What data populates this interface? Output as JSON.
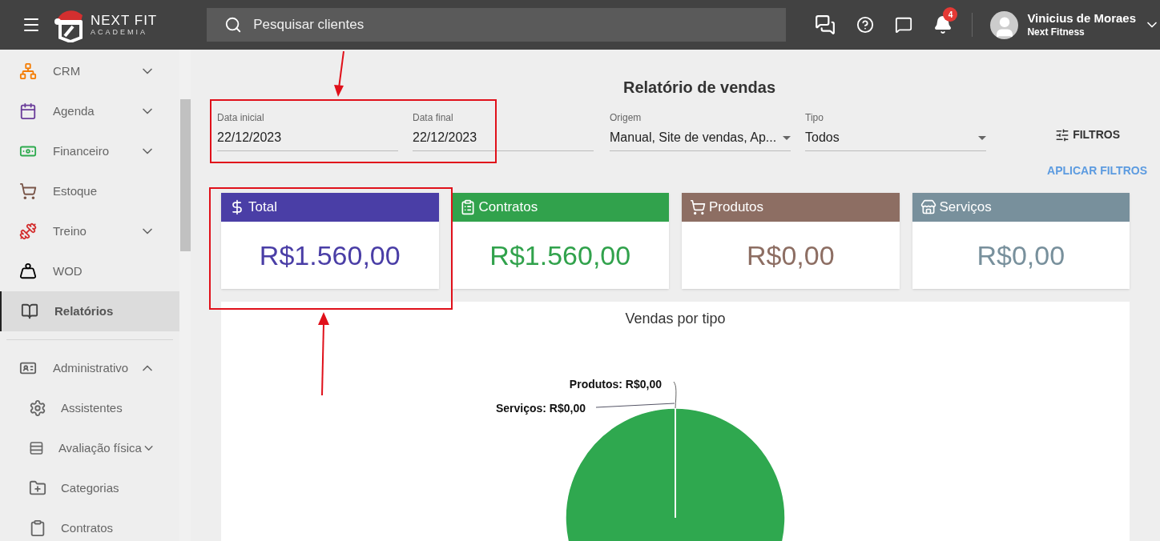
{
  "header": {
    "logo": {
      "title": "NEXT FIT",
      "subtitle": "ACADEMIA"
    },
    "search": {
      "placeholder": "Pesquisar clientes"
    },
    "notifications": {
      "count": "4"
    },
    "user": {
      "name": "Vinicius de Moraes",
      "company": "Next Fitness"
    }
  },
  "sidebar": {
    "sections": [
      {
        "items": [
          {
            "label": "CRM",
            "expanded": false,
            "selected": false
          },
          {
            "label": "Agenda",
            "expanded": false,
            "selected": false
          },
          {
            "label": "Financeiro",
            "expanded": false,
            "selected": false
          },
          {
            "label": "Estoque",
            "selected": false
          },
          {
            "label": "Treino",
            "expanded": false,
            "selected": false
          },
          {
            "label": "WOD",
            "selected": false
          },
          {
            "label": "Relatórios",
            "selected": true
          }
        ]
      },
      {
        "items": [
          {
            "label": "Administrativo",
            "expanded": true,
            "selected": false,
            "children": [
              {
                "label": "Assistentes",
                "selected": false
              },
              {
                "label": "Avaliação física",
                "expanded": false,
                "selected": false
              },
              {
                "label": "Categorias",
                "selected": false
              },
              {
                "label": "Contratos",
                "selected": false
              }
            ]
          }
        ]
      }
    ]
  },
  "report": {
    "title": "Relatório de vendas",
    "filters": [
      {
        "kind": "text",
        "label": "Data inicial",
        "value": "22/12/2023"
      },
      {
        "kind": "text",
        "label": "Data final",
        "value": "22/12/2023"
      },
      {
        "kind": "select",
        "label": "Origem",
        "value": "Manual, Site de vendas, Ap..."
      },
      {
        "kind": "select",
        "label": "Tipo",
        "value": "Todos"
      }
    ],
    "filters_button": "FILTROS",
    "apply_button": "APLICAR FILTROS",
    "cards": [
      {
        "title": "Total",
        "value": "R$1.560,00",
        "color": "#4a3ea6"
      },
      {
        "title": "Contratos",
        "value": "R$1.560,00",
        "color": "#31a24c"
      },
      {
        "title": "Produtos",
        "value": "R$0,00",
        "color": "#8d6e63"
      },
      {
        "title": "Serviços",
        "value": "R$0,00",
        "color": "#78909c"
      }
    ],
    "chart": {
      "chart_data": {
        "type": "pie",
        "title": "Vendas por tipo",
        "series": [
          {
            "color": "#2fa84f",
            "values": [
              100,
              0,
              0
            ]
          }
        ],
        "annotations": [
          {
            "text": "Produtos: R$0,00"
          },
          {
            "text": "Serviços: R$0,00"
          }
        ]
      }
    }
  }
}
